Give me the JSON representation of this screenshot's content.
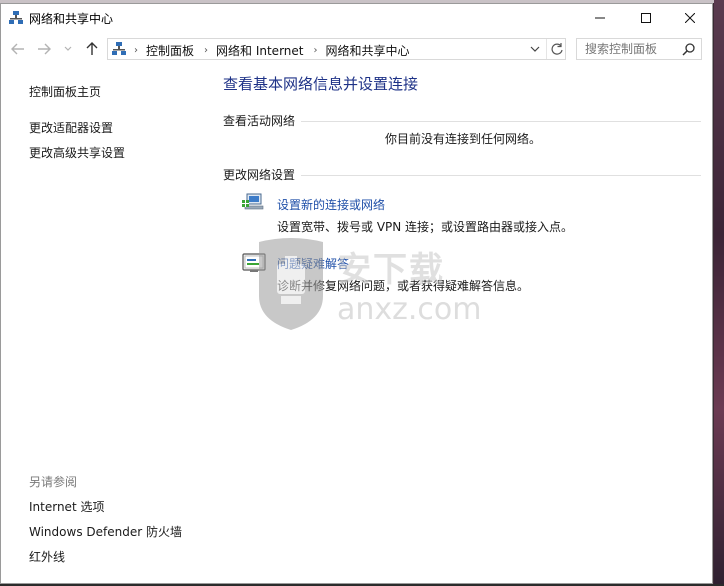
{
  "window": {
    "title": "网络和共享中心",
    "controls": {
      "minimize": "—",
      "maximize": "☐",
      "close": "✕"
    }
  },
  "nav": {
    "back": "←",
    "forward": "→",
    "recent": "⌄",
    "up": "↑"
  },
  "address": {
    "crumbs": [
      "控制面板",
      "网络和 Internet",
      "网络和共享中心"
    ],
    "separator": "›",
    "dropdown": "∨",
    "refresh": "↻"
  },
  "search": {
    "placeholder": "搜索控制面板"
  },
  "sidebar": {
    "home": "控制面板主页",
    "items": [
      "更改适配器设置",
      "更改高级共享设置"
    ],
    "see_also_heading": "另请参阅",
    "see_also": [
      "Internet 选项",
      "Windows Defender 防火墙",
      "红外线"
    ]
  },
  "main": {
    "title": "查看基本网络信息并设置连接",
    "active_networks": {
      "heading": "查看活动网络",
      "status": "你目前没有连接到任何网络。"
    },
    "change_settings": {
      "heading": "更改网络设置",
      "tasks": [
        {
          "icon": "new-connection-icon",
          "link": "设置新的连接或网络",
          "desc": "设置宽带、拨号或 VPN 连接；或设置路由器或接入点。"
        },
        {
          "icon": "troubleshoot-icon",
          "link": "问题疑难解答",
          "desc": "诊断并修复网络问题，或者获得疑难解答信息。"
        }
      ]
    }
  },
  "watermark": {
    "cn": "安下载",
    "en": "anxz.com"
  },
  "colors": {
    "title_blue": "#1e3287",
    "link_blue": "#1f4fa8",
    "muted": "#7a7a7a"
  }
}
